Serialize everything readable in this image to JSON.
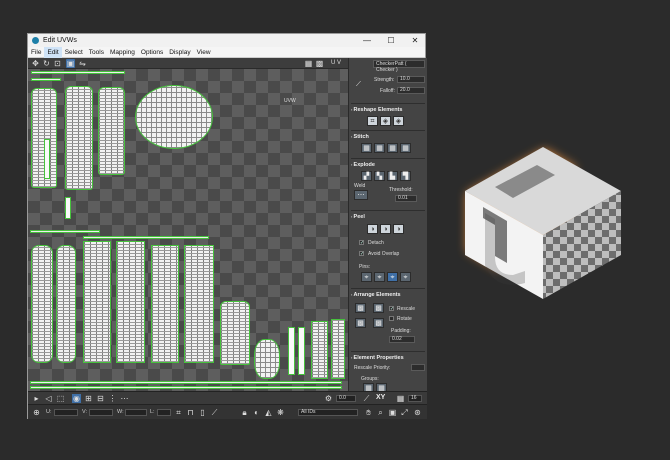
{
  "window": {
    "title": "Edit UVWs",
    "controls": {
      "minimize": "—",
      "maximize": "☐",
      "close": "✕"
    }
  },
  "menu": [
    "File",
    "Edit",
    "Select",
    "Tools",
    "Mapping",
    "Options",
    "Display",
    "View"
  ],
  "active_menu": "Edit",
  "toolbar": {
    "uv_label": "U V",
    "map_combo": "CheckerPatt ( Checker )"
  },
  "viewport": {
    "uvw_label": "UVW"
  },
  "panel": {
    "strength_label": "Strength:",
    "strength_value": "10.0",
    "falloff_label": "Falloff:",
    "falloff_value": "20.0",
    "reshape_title": "Reshape Elements",
    "stitch_title": "Stitch",
    "explode_title": "Explode",
    "weld_label": "Weld",
    "threshold_label": "Threshold:",
    "threshold_value": "0.01",
    "peel_title": "Peel",
    "detach_label": "Detach",
    "avoid_overlap_label": "Avoid Overlap",
    "pins_label": "Pins:",
    "arrange_title": "Arrange Elements",
    "rescale_label": "Rescale",
    "rotate_label": "Rotate",
    "padding_label": "Padding:",
    "padding_value": "0.02",
    "element_props_title": "Element Properties",
    "rescale_priority_label": "Rescale Priority:",
    "groups_label": "Groups:"
  },
  "bottom": {
    "u_label": "U:",
    "v_label": "V:",
    "w_label": "W:",
    "l_label": "L:",
    "spinner_value": "0.0",
    "xy_label": "XY",
    "grid_value": "16",
    "filter_combo": "All IDs"
  },
  "colors": {
    "accent": "#3f6fa6",
    "uv_edge": "#46c23c",
    "logo_glow": "#ff9a3c"
  }
}
